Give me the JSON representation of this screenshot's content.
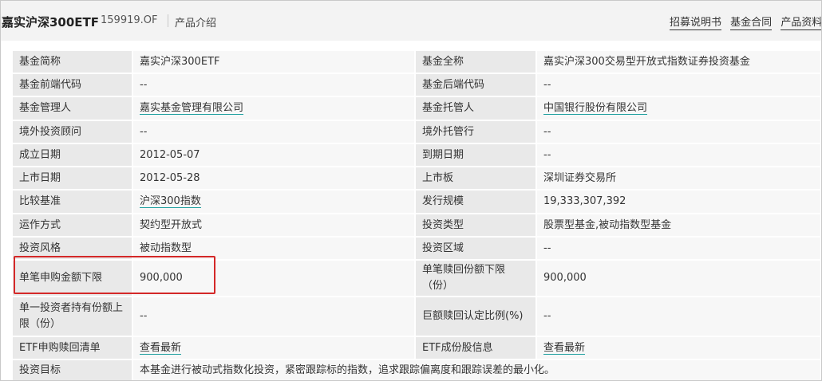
{
  "header": {
    "fund_name": "嘉实沪深300ETF",
    "fund_code": "159919.OF",
    "product_intro": "产品介绍",
    "links": [
      "招募说明书",
      "基金合同",
      "产品资料"
    ]
  },
  "rows": [
    {
      "l1": "基金简称",
      "v1": "嘉实沪深300ETF",
      "l2": "基金全称",
      "v2": "嘉实沪深300交易型开放式指数证券投资基金"
    },
    {
      "l1": "基金前端代码",
      "v1": "--",
      "l2": "基金后端代码",
      "v2": "--"
    },
    {
      "l1": "基金管理人",
      "v1": "嘉实基金管理有限公司",
      "l2": "基金托管人",
      "v2": "中国银行股份有限公司"
    },
    {
      "l1": "境外投资顾问",
      "v1": "--",
      "l2": "境外托管行",
      "v2": "--"
    },
    {
      "l1": "成立日期",
      "v1": "2012-05-07",
      "l2": "到期日期",
      "v2": "--"
    },
    {
      "l1": "上市日期",
      "v1": "2012-05-28",
      "l2": "上市板",
      "v2": "深圳证券交易所"
    },
    {
      "l1": "比较基准",
      "v1": "沪深300指数",
      "l2": "发行规模",
      "v2": "19,333,307,392"
    },
    {
      "l1": "运作方式",
      "v1": "契约型开放式",
      "l2": "投资类型",
      "v2": "股票型基金,被动指数型基金"
    },
    {
      "l1": "投资风格",
      "v1": "被动指数型",
      "l2": "投资区域",
      "v2": "--"
    },
    {
      "l1": "单笔申购金额下限",
      "v1": "900,000",
      "l2": "单笔赎回份额下限（份）",
      "v2": "900,000"
    },
    {
      "l1": "单一投资者持有份额上限（份）",
      "v1": "--",
      "l2": "巨额赎回认定比例(%)",
      "v2": "--"
    },
    {
      "l1": "ETF申购赎回清单",
      "v1": "查看最新",
      "l2": "ETF成份股信息",
      "v2": "查看最新"
    }
  ],
  "goal": {
    "label": "投资目标",
    "value": "本基金进行被动式指数化投资，紧密跟踪标的指数，追求跟踪偏离度和跟踪误差的最小化。"
  }
}
